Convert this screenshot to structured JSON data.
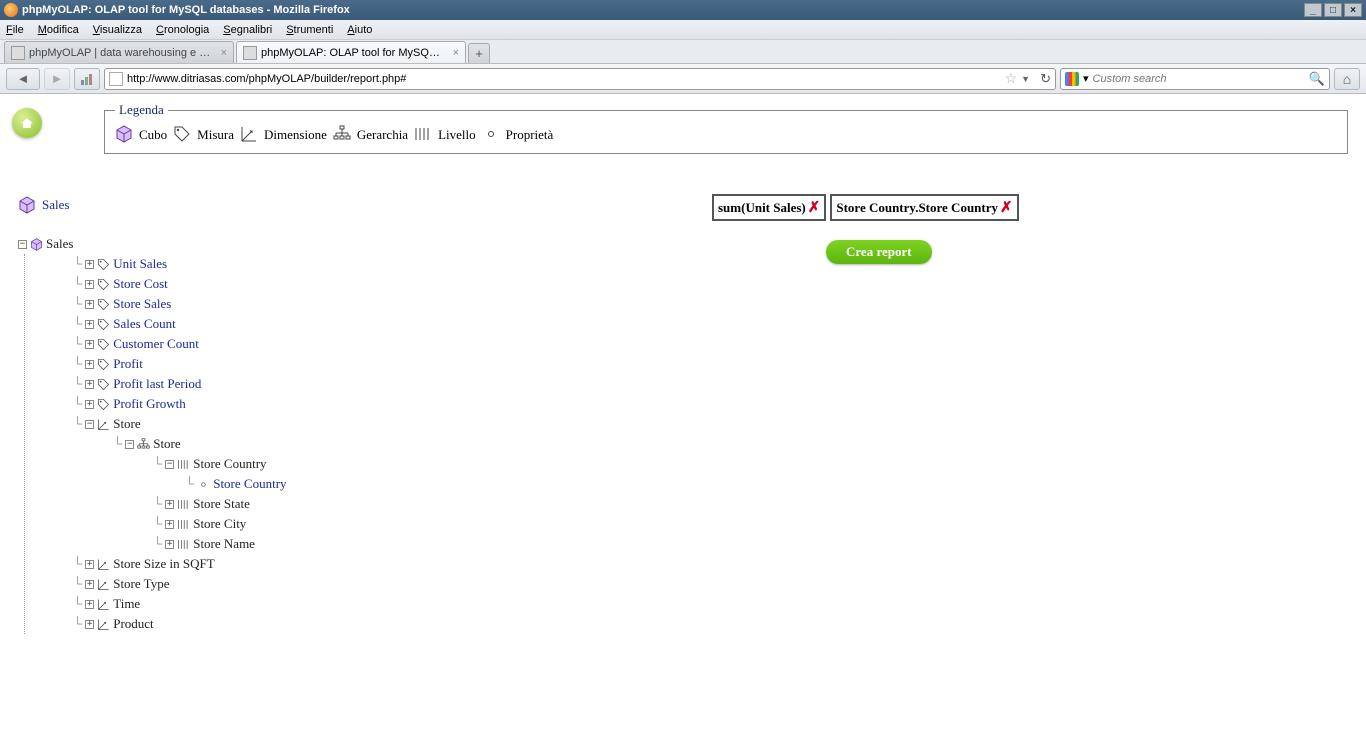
{
  "window": {
    "title": "phpMyOLAP: OLAP tool for MySQL databases - Mozilla Firefox"
  },
  "menu": {
    "file": "File",
    "modifica": "Modifica",
    "visualizza": "Visualizza",
    "cronologia": "Cronologia",
    "segnalibri": "Segnalibri",
    "strumenti": "Strumenti",
    "aiuto": "Aiuto"
  },
  "tabs": {
    "t0": "phpMyOLAP | data warehousing e analisi ...",
    "t1": "phpMyOLAP: OLAP tool for MySQL datab..."
  },
  "nav": {
    "url": "http://www.ditriasas.com/phpMyOLAP/builder/report.php#",
    "search_placeholder": "Custom search"
  },
  "legend": {
    "title": "Legenda",
    "cubo": "Cubo",
    "misura": "Misura",
    "dimensione": "Dimensione",
    "gerarchia": "Gerarchia",
    "livello": "Livello",
    "proprieta": "Proprietà"
  },
  "cube": {
    "name": "Sales"
  },
  "tree": {
    "root": "Sales",
    "m0": "Unit Sales",
    "m1": "Store Cost",
    "m2": "Store Sales",
    "m3": "Sales Count",
    "m4": "Customer Count",
    "m5": "Profit",
    "m6": "Profit last Period",
    "m7": "Profit Growth",
    "d0": "Store",
    "d0_h0": "Store",
    "d0_h0_l0": "Store Country",
    "d0_h0_l0_p0": "Store Country",
    "d0_h0_l1": "Store State",
    "d0_h0_l2": "Store City",
    "d0_h0_l3": "Store Name",
    "d1": "Store Size in SQFT",
    "d2": "Store Type",
    "d3": "Time",
    "d4": "Product"
  },
  "drops": {
    "d0": "sum(Unit Sales)",
    "d1": "Store Country.Store Country"
  },
  "actions": {
    "create_report": "Crea report"
  }
}
